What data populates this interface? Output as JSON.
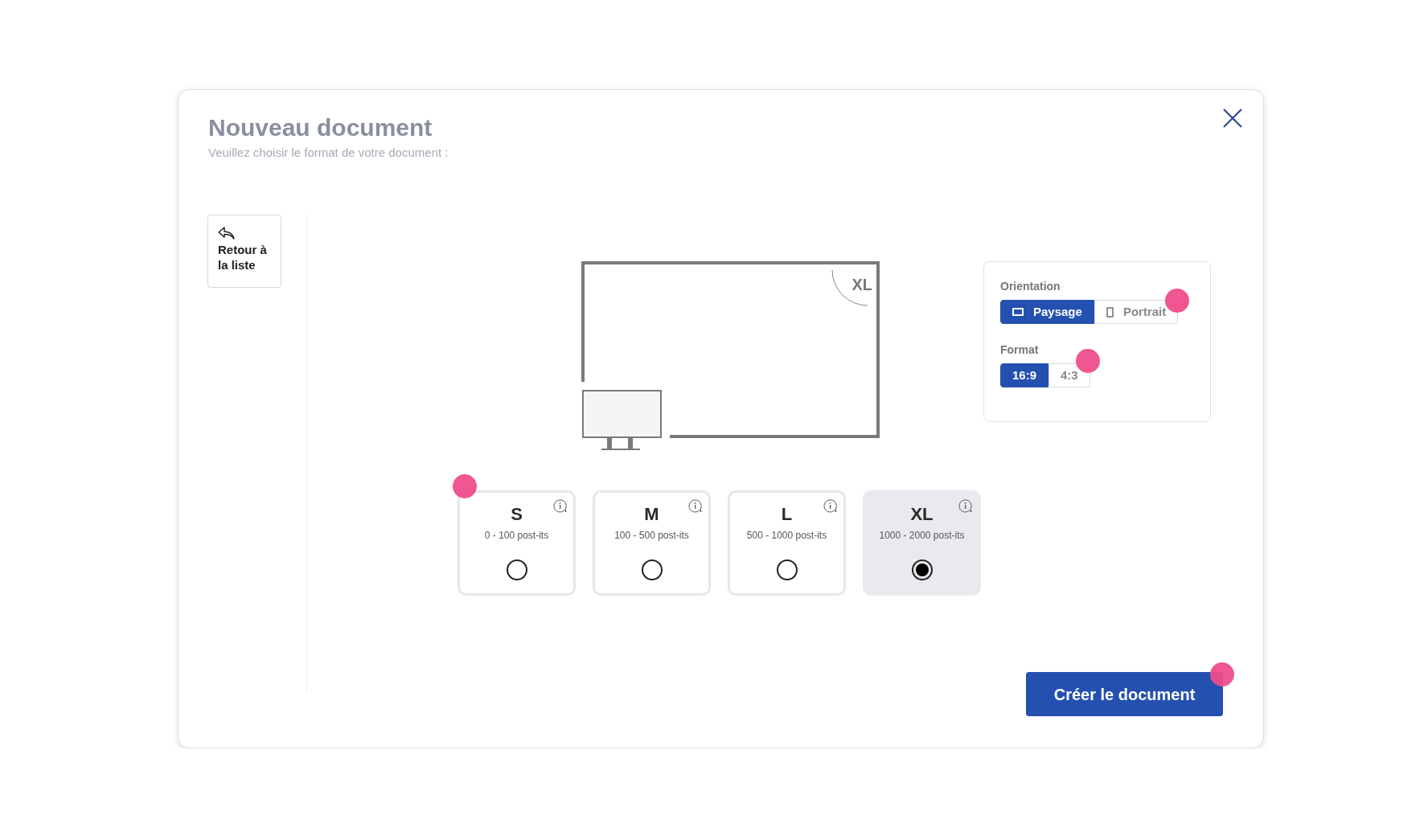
{
  "dialog": {
    "title": "Nouveau document",
    "subtitle": "Veuillez choisir le format de votre document :"
  },
  "back_button": {
    "label": "Retour à la liste"
  },
  "preview": {
    "label": "XL"
  },
  "orientation": {
    "label": "Orientation",
    "marker": true,
    "options": [
      {
        "label": "Paysage",
        "kind": "landscape",
        "selected": true
      },
      {
        "label": "Portrait",
        "kind": "portrait",
        "selected": false
      }
    ]
  },
  "format": {
    "label": "Format",
    "marker": true,
    "options": [
      {
        "label": "16:9",
        "selected": true
      },
      {
        "label": "4:3",
        "selected": false
      }
    ]
  },
  "sizes": [
    {
      "name": "S",
      "range": "0 - 100 post-its",
      "selected": false,
      "marker": true
    },
    {
      "name": "M",
      "range": "100 - 500 post-its",
      "selected": false,
      "marker": false
    },
    {
      "name": "L",
      "range": "500 - 1000 post-its",
      "selected": false,
      "marker": false
    },
    {
      "name": "XL",
      "range": "1000 - 2000 post-its",
      "selected": true,
      "marker": false
    }
  ],
  "create_button": {
    "label": "Créer le document",
    "marker": true
  }
}
